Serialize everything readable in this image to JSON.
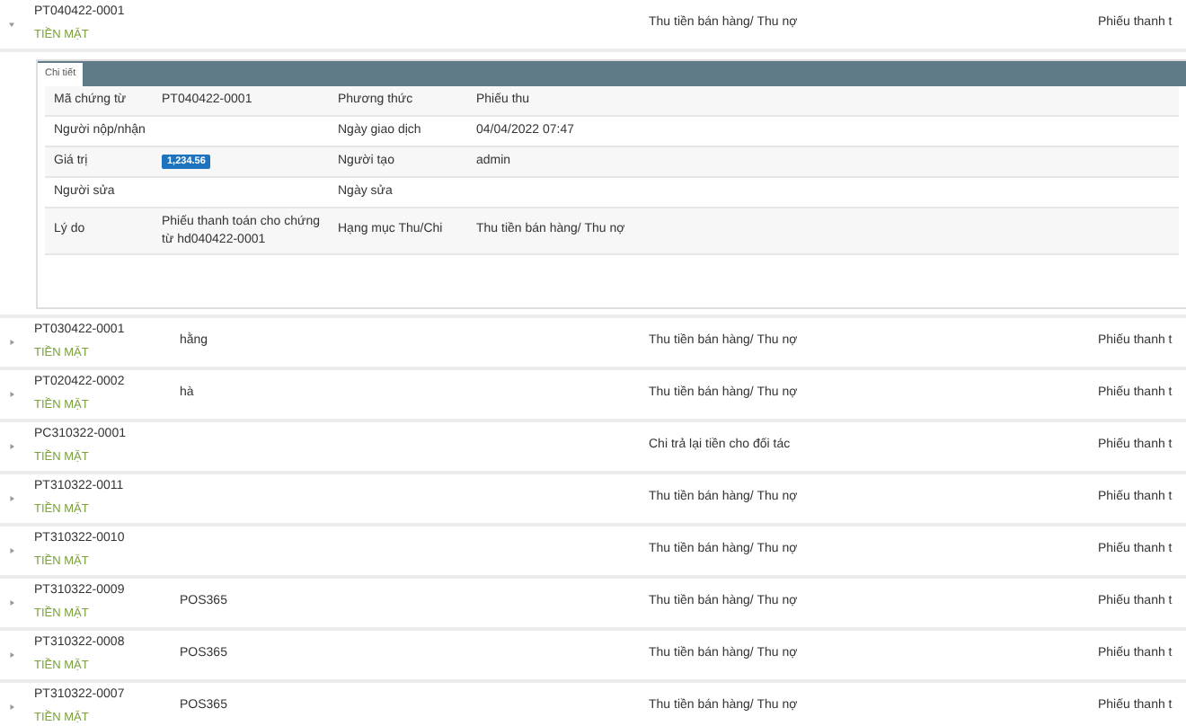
{
  "detail_tab": {
    "label": "Chi tiết",
    "selected": true
  },
  "detail_fields": [
    {
      "label_1": "Mã chứng từ",
      "value_1": "PT040422-0001",
      "label_2": "Phương thức",
      "value_2": "Phiếu thu"
    },
    {
      "label_1": "Người nộp/nhận",
      "label_2": "Ngày giao dịch",
      "value_2": "04/04/2022 07:47"
    },
    {
      "label_1": "Giá trị",
      "value_1": "1,234.56",
      "kind": "badge",
      "label_2": "Người tạo",
      "value_2": "admin"
    },
    {
      "label_1": "Người sửa",
      "label_2": "Ngày sửa"
    },
    {
      "label_1": "Lý do",
      "value_1": "Phiếu thanh toán cho chứng từ hd040422-0001",
      "label_2": "Hạng mục Thu/Chi",
      "value_2": "Thu tiền bán hàng/ Thu nợ"
    }
  ],
  "rows": [
    {
      "code": "PT040422-0001",
      "method": "TIỀN MẶT",
      "column_2": "",
      "column_3": "Thu tiền bán hàng/ Thu nợ",
      "column_4": "Phiếu thanh t",
      "expanded": true
    },
    {
      "code": "PT030422-0001",
      "method": "TIỀN MẶT",
      "column_2": "hằng",
      "column_3": "Thu tiền bán hàng/ Thu nợ",
      "column_4": "Phiếu thanh t",
      "expanded": false
    },
    {
      "code": "PT020422-0002",
      "method": "TIỀN MẶT",
      "column_2": "hà",
      "column_3": "Thu tiền bán hàng/ Thu nợ",
      "column_4": "Phiếu thanh t",
      "expanded": false
    },
    {
      "code": "PC310322-0001",
      "method": "TIỀN MẶT",
      "column_2": "",
      "column_3": "Chi trả lại tiền cho đối tác",
      "column_4": "Phiếu thanh t",
      "expanded": false
    },
    {
      "code": "PT310322-0011",
      "method": "TIỀN MẶT",
      "column_2": "",
      "column_3": "Thu tiền bán hàng/ Thu nợ",
      "column_4": "Phiếu thanh t",
      "expanded": false
    },
    {
      "code": "PT310322-0010",
      "method": "TIỀN MẶT",
      "column_2": "",
      "column_3": "Thu tiền bán hàng/ Thu nợ",
      "column_4": "Phiếu thanh t",
      "expanded": false
    },
    {
      "code": "PT310322-0009",
      "method": "TIỀN MẶT",
      "column_2": "POS365",
      "column_3": "Thu tiền bán hàng/ Thu nợ",
      "column_4": "Phiếu thanh t",
      "expanded": false
    },
    {
      "code": "PT310322-0008",
      "method": "TIỀN MẶT",
      "column_2": "POS365",
      "column_3": "Thu tiền bán hàng/ Thu nợ",
      "column_4": "Phiếu thanh t",
      "expanded": false
    },
    {
      "code": "PT310322-0007",
      "method": "TIỀN MẶT",
      "column_2": "POS365",
      "column_3": "Thu tiền bán hàng/ Thu nợ",
      "column_4": "Phiếu thanh t",
      "expanded": false
    }
  ]
}
